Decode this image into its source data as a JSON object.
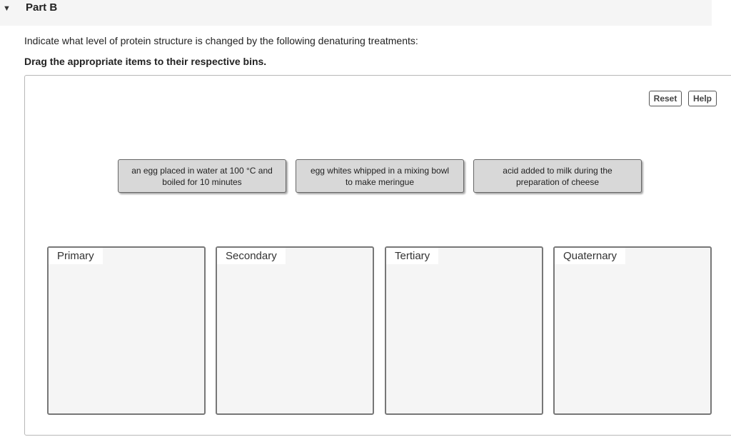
{
  "part": {
    "toggle_icon": "triangle-down",
    "title": "Part B"
  },
  "question": {
    "instruction": "Indicate what level of protein structure is changed by the following denaturing treatments:",
    "directive": "Drag the appropriate items to their respective bins."
  },
  "toolbar": {
    "reset_label": "Reset",
    "help_label": "Help"
  },
  "items": [
    {
      "line1": "an egg placed in water at 100 °C and",
      "line2": "boiled for 10 minutes"
    },
    {
      "line1": "egg whites whipped in a mixing bowl",
      "line2": "to make meringue"
    },
    {
      "line1": "acid added to milk during the",
      "line2": "preparation of cheese"
    }
  ],
  "bins": [
    {
      "label": "Primary"
    },
    {
      "label": "Secondary"
    },
    {
      "label": "Tertiary"
    },
    {
      "label": "Quaternary"
    }
  ]
}
